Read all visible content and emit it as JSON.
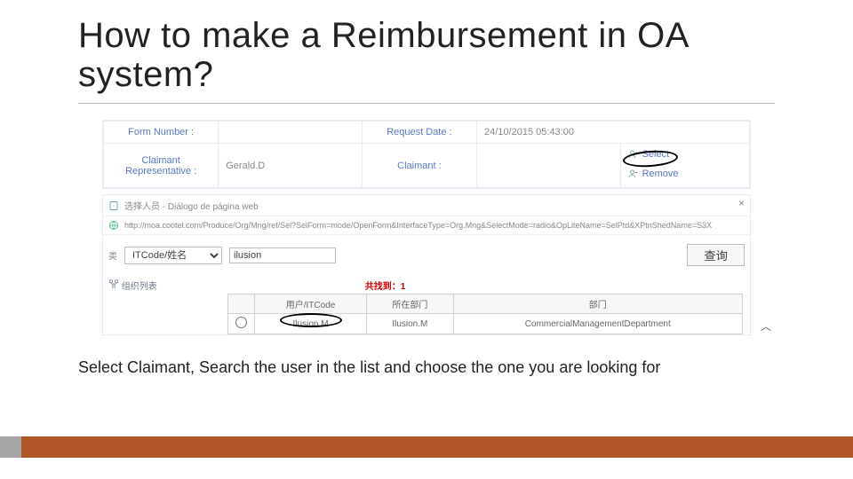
{
  "title": "How to make a Reimbursement in OA system?",
  "form": {
    "formNumberLabel": "Form Number :",
    "formNumberValue": "",
    "requestDateLabel": "Request Date :",
    "requestDateValue": "24/10/2015 05:43:00",
    "claimantRepLabel": "Claimant Representative :",
    "claimantRepValue": "Gerald.D",
    "claimantLabel": "Claimant :",
    "selectAction": "Select",
    "removeAction": "Remove"
  },
  "dialog": {
    "titleText": "选择人员 - Diálogo de página web",
    "url": "http://moa.cootel.com/Produce/Org/Mng/ref/Sel?SelForm=mode/OpenForm&InterfaceType=Org.Mng&SelectMode=radio&OpLiteName=SelPtd&XPtnShedName=S3X",
    "searchTypeLabel": "类",
    "searchTypeValue": "ITCode/姓名",
    "searchInputValue": "ilusion",
    "searchButton": "查询",
    "treeButton": "组织列表",
    "foundText": "共找到：1",
    "columns": {
      "c0": "",
      "c1": "用户/ITCode",
      "c2": "所在部门",
      "c3": "部门"
    },
    "row": {
      "selected": false,
      "user": "Ilusion.M",
      "dept": "Ilusion.M",
      "department": "CommercialManagementDepartment"
    }
  },
  "caption": "Select Claimant, Search the user in the list and choose the one you are looking for"
}
